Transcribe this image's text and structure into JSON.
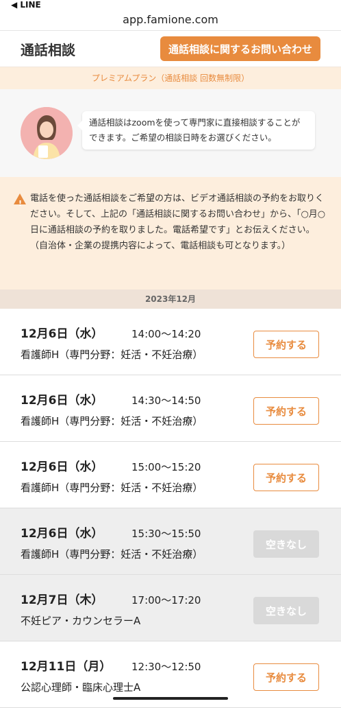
{
  "statusbar": {
    "back_label": "◀ LINE"
  },
  "browser": {
    "url": "app.famione.com"
  },
  "header": {
    "title": "通話相談",
    "contact_button": "通話相談に関するお問い合わせ"
  },
  "plan_banner": "プレミアムプラン（通話相談 回数無制限）",
  "intro": {
    "bubble_text": "通話相談はzoomを使って専門家に直接相談することができます。ご希望の相談日時をお選びください。"
  },
  "notice": {
    "text": "電話を使った通話相談をご希望の方は、ビデオ通話相談の予約をお取りください。そして、上記の「通話相談に関するお問い合わせ」から、「○月○日に通話相談の予約を取りました。電話希望です」とお伝えください。（自治体・企業の提携内容によって、電話相談も可となります。）"
  },
  "month_label": "2023年12月",
  "slots": [
    {
      "date": "12月6日（水）",
      "time": "14:00〜14:20",
      "staff": "看護師H（専門分野：妊活・不妊治療）",
      "button": "予約する",
      "available": true
    },
    {
      "date": "12月6日（水）",
      "time": "14:30〜14:50",
      "staff": "看護師H（専門分野：妊活・不妊治療）",
      "button": "予約する",
      "available": true
    },
    {
      "date": "12月6日（水）",
      "time": "15:00〜15:20",
      "staff": "看護師H（専門分野：妊活・不妊治療）",
      "button": "予約する",
      "available": true
    },
    {
      "date": "12月6日（水）",
      "time": "15:30〜15:50",
      "staff": "看護師H（専門分野：妊活・不妊治療）",
      "button": "空きなし",
      "available": false
    },
    {
      "date": "12月7日（木）",
      "time": "17:00〜17:20",
      "staff": "不妊ピア・カウンセラーA",
      "button": "空きなし",
      "available": false
    },
    {
      "date": "12月11日（月）",
      "time": "12:30〜12:50",
      "staff": "公認心理師・臨床心理士A",
      "button": "予約する",
      "available": true
    }
  ],
  "colors": {
    "accent": "#e88b3e",
    "banner_bg": "#fdeedd",
    "full_bg": "#eeeeee"
  }
}
